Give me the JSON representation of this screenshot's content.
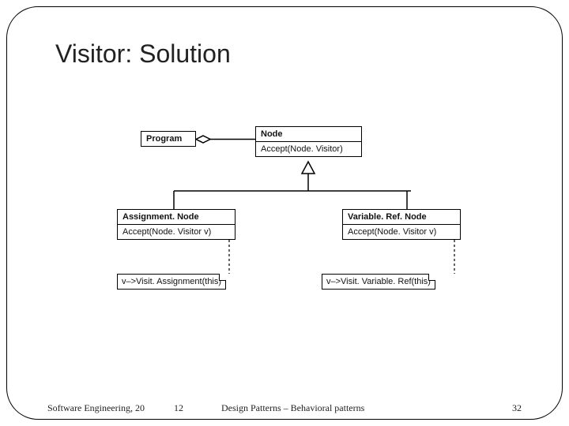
{
  "title": "Visitor: Solution",
  "footer": {
    "left1": "Software Engineering, 20",
    "left2": "12",
    "center": "Design Patterns – Behavioral patterns",
    "page": "32"
  },
  "uml": {
    "program": {
      "name": "Program"
    },
    "node": {
      "name": "Node",
      "op": "Accept(Node. Visitor)"
    },
    "assignment": {
      "name": "Assignment. Node",
      "op": "Accept(Node. Visitor v)",
      "note": "v–>Visit. Assignment(this)"
    },
    "variableref": {
      "name": "Variable. Ref. Node",
      "op": "Accept(Node. Visitor v)",
      "note": "v–>Visit. Variable. Ref(this)"
    }
  }
}
